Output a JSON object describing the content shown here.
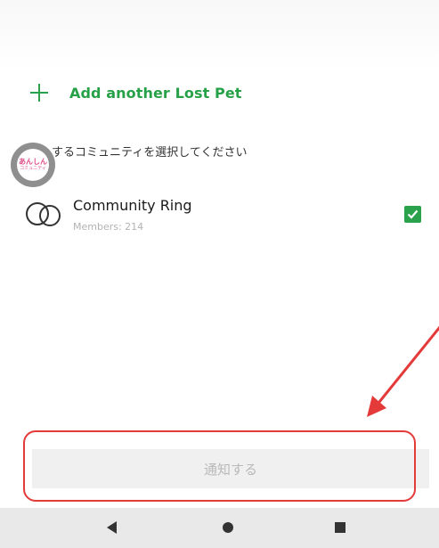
{
  "add_pet": {
    "label": "Add another Lost Pet"
  },
  "community_section": {
    "title": "するコミュニティを選択してください",
    "app_badge": {
      "line1": "あんしん",
      "line2": "コミュニティ"
    }
  },
  "community": {
    "name": "Community Ring",
    "members": "Members: 214",
    "checked": true
  },
  "notify_button": {
    "label": "通知する",
    "enabled": false
  },
  "nav_bar": {
    "back": "back-icon",
    "home": "home-icon",
    "recents": "recents-icon"
  },
  "colors": {
    "accent_green": "#2aa24b",
    "annotation_red": "#e53a3a",
    "disabled_text": "#b9b9b9"
  }
}
